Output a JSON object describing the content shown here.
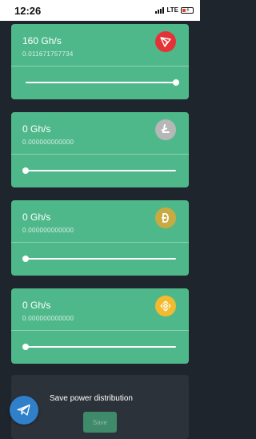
{
  "status_bar": {
    "time": "12:26",
    "network": "LTE"
  },
  "cards": [
    {
      "rate": "160 Gh/s",
      "amount": "0.011671757734",
      "coin_icon": "tron-icon",
      "coin_color": "#e53237",
      "slider_fraction": 1.0
    },
    {
      "rate": "0 Gh/s",
      "amount": "0.000000000000",
      "coin_icon": "litecoin-icon",
      "coin_color": "#b7b7b7",
      "slider_fraction": 0.0
    },
    {
      "rate": "0 Gh/s",
      "amount": "0.000000000000",
      "coin_icon": "dogecoin-icon",
      "coin_color": "#c9aa40",
      "slider_fraction": 0.0
    },
    {
      "rate": "0 Gh/s",
      "amount": "0.000000000000",
      "coin_icon": "binance-icon",
      "coin_color": "#f3ba2f",
      "slider_fraction": 0.0
    }
  ],
  "save_panel": {
    "title": "Save power distribution",
    "button_label": "Save"
  },
  "fab": {
    "icon": "telegram-icon",
    "color": "#2f7fc9"
  },
  "colors": {
    "card": "#4fb88a",
    "background": "#1f252c"
  }
}
